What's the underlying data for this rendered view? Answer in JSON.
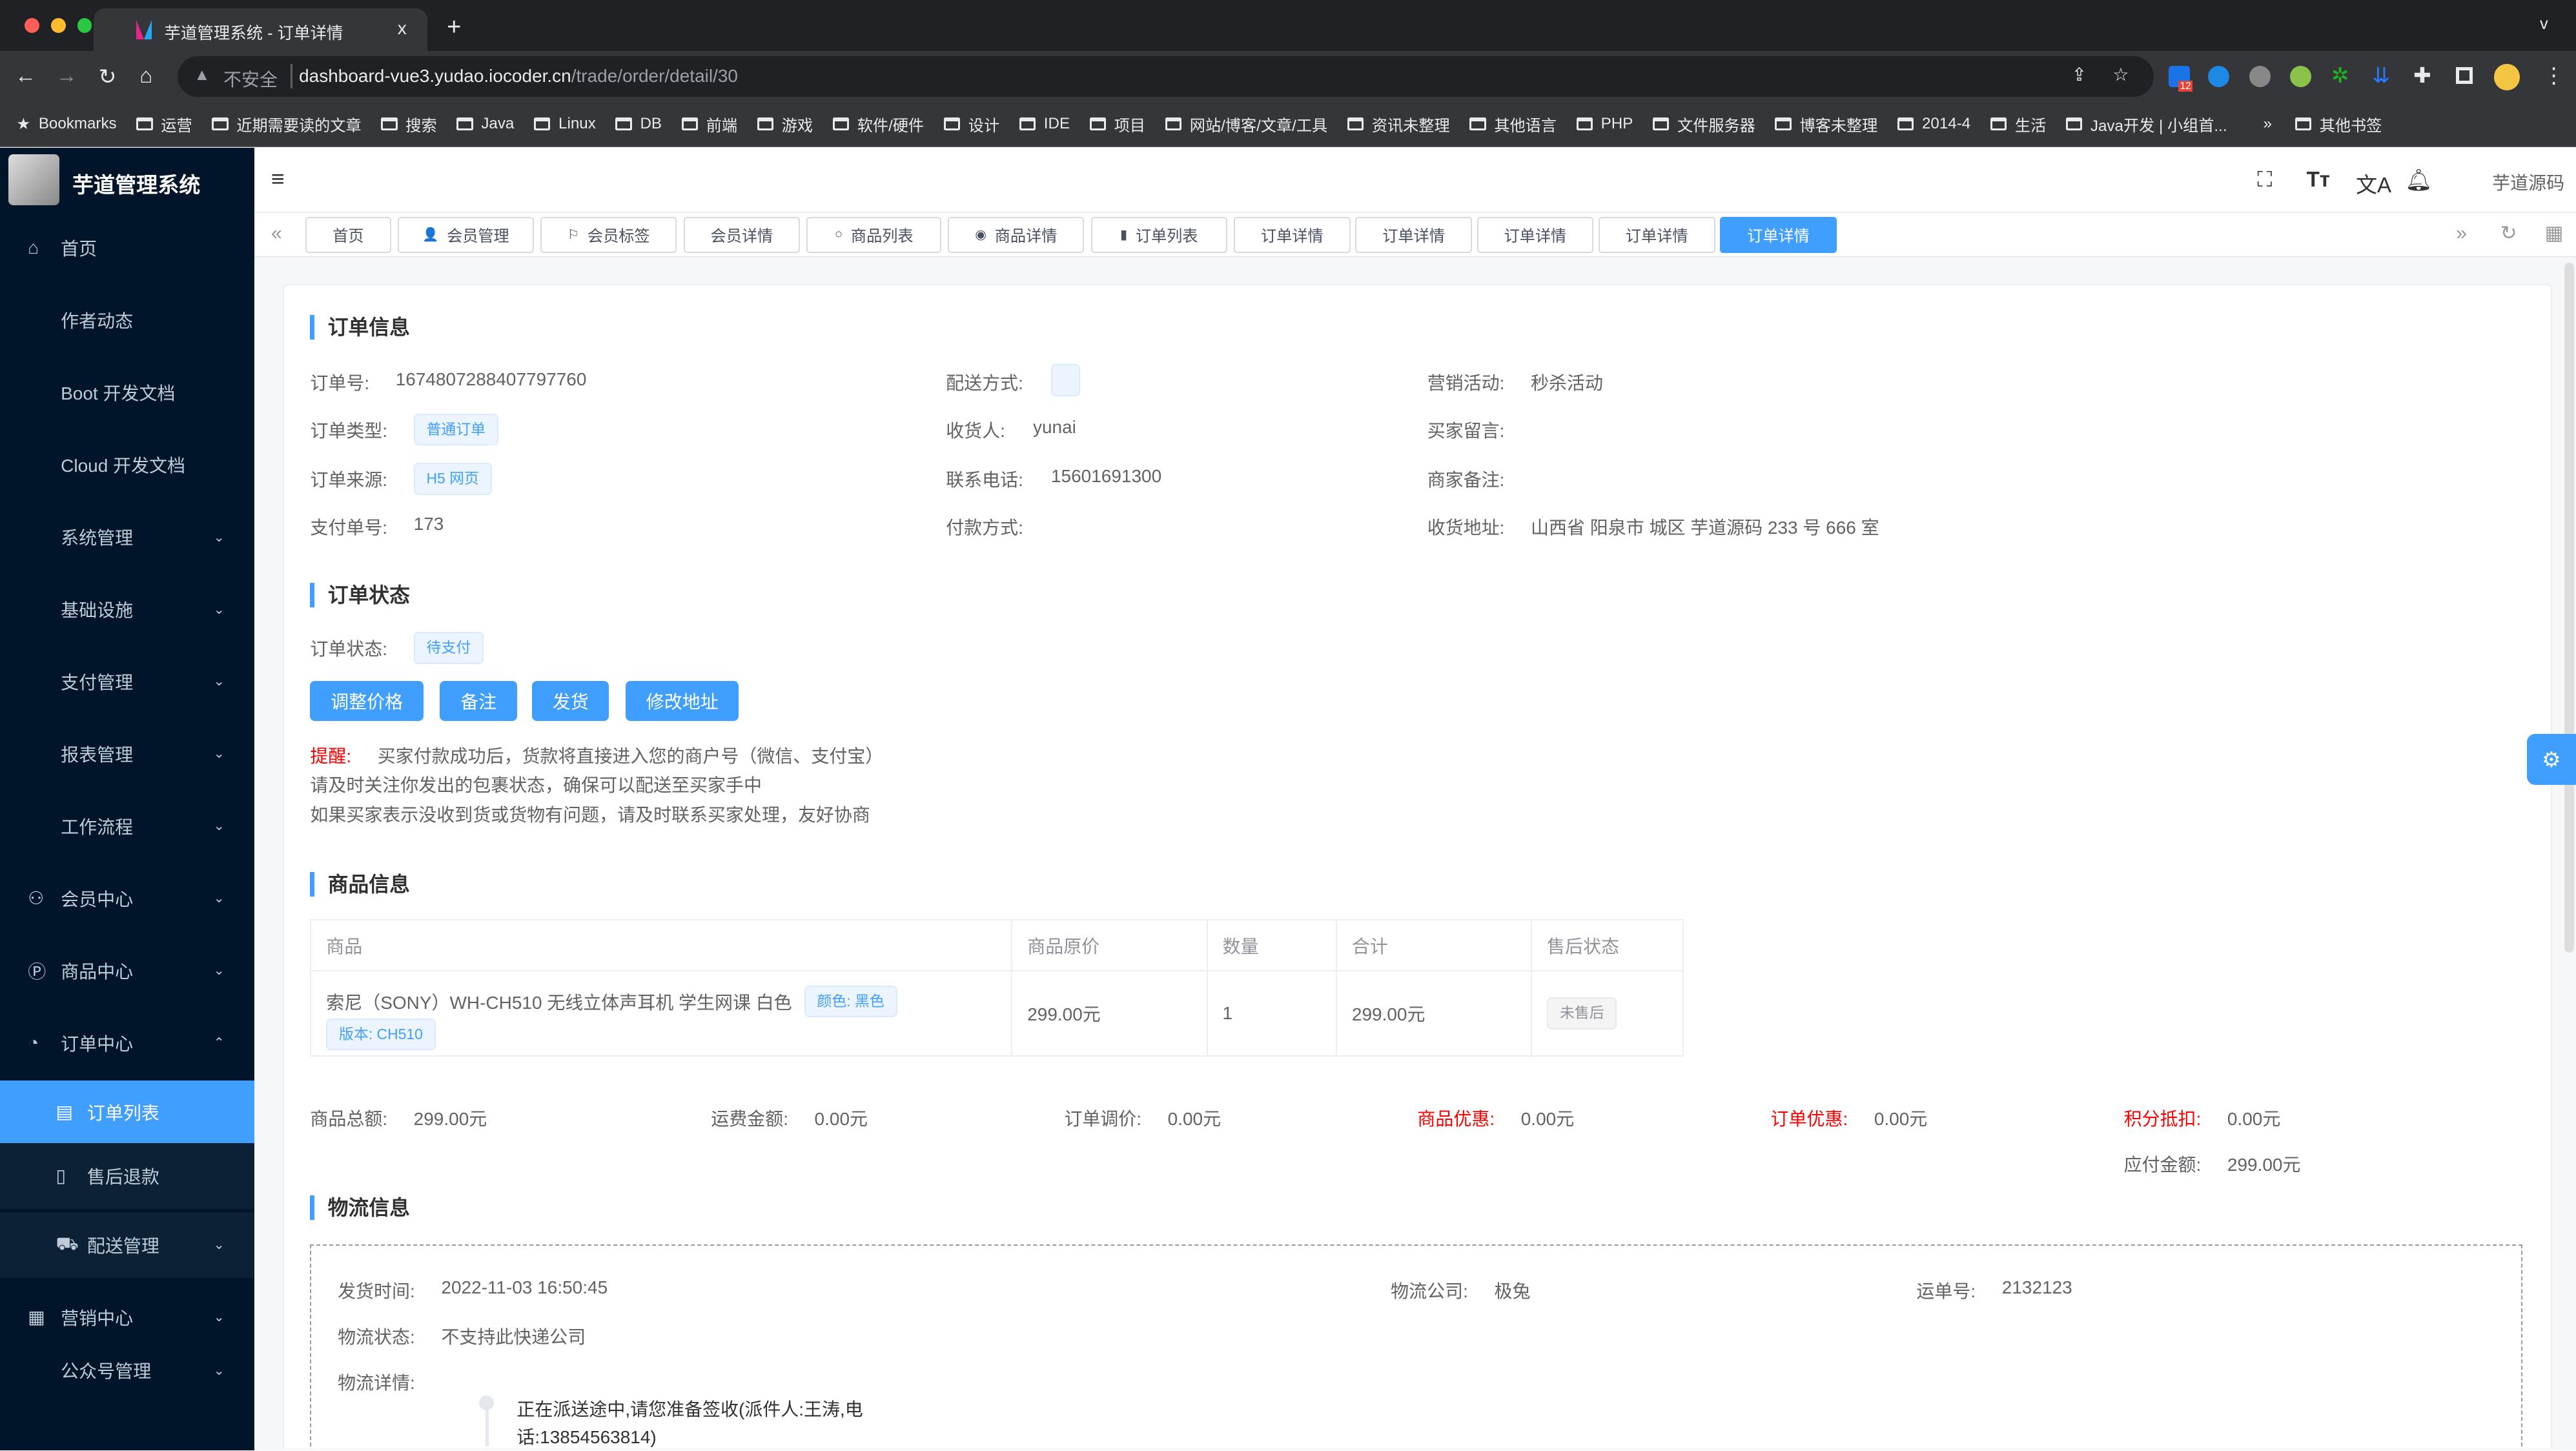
{
  "browser": {
    "tab_title": "芋道管理系统 - 订单详情",
    "close": "x",
    "new_tab": "+",
    "tab_menu": "v",
    "security": "不安全",
    "url_host": "dashboard-vue3.yudao.iocoder.cn",
    "url_path": "/trade/order/detail/30",
    "extension_badge": "12",
    "bookmarks": [
      "Bookmarks",
      "运营",
      "近期需要读的文章",
      "搜索",
      "Java",
      "Linux",
      "DB",
      "前端",
      "游戏",
      "软件/硬件",
      "设计",
      "IDE",
      "项目",
      "网站/博客/文章/工具",
      "资讯未整理",
      "其他语言",
      "PHP",
      "文件服务器",
      "博客未整理",
      "2014-4",
      "生活",
      "Java开发 | 小组首...",
      "»",
      "其他书签"
    ]
  },
  "app": {
    "title": "芋道管理系统",
    "header_user": "芋道源码",
    "menu": [
      {
        "label": "首页",
        "icon": "home-icon",
        "glyph": "⌂"
      },
      {
        "label": "作者动态"
      },
      {
        "label": "Boot 开发文档"
      },
      {
        "label": "Cloud 开发文档"
      },
      {
        "label": "系统管理",
        "arrow": "⌄"
      },
      {
        "label": "基础设施",
        "arrow": "⌄"
      },
      {
        "label": "支付管理",
        "arrow": "⌄"
      },
      {
        "label": "报表管理",
        "arrow": "⌄"
      },
      {
        "label": "工作流程",
        "arrow": "⌄"
      },
      {
        "label": "会员中心",
        "icon": "members-icon",
        "glyph": "⚇",
        "arrow": "⌄"
      },
      {
        "label": "商品中心",
        "icon": "product-icon",
        "glyph": "Ⓟ",
        "arrow": "⌄"
      },
      {
        "label": "订单中心",
        "icon": "order-icon",
        "glyph": "◔",
        "arrow": "⌃"
      },
      {
        "label": "订单列表",
        "icon": "list-icon",
        "glyph": "▤",
        "sub": true,
        "active": true
      },
      {
        "label": "售后退款",
        "icon": "refund-icon",
        "glyph": "▯",
        "sub": true
      },
      {
        "label": "配送管理",
        "icon": "cart-icon",
        "glyph": "⛟",
        "sub": true,
        "arrow": "⌄"
      },
      {
        "label": "营销中心",
        "icon": "marketing-icon",
        "glyph": "▦",
        "arrow": "⌄"
      },
      {
        "label": "公众号管理",
        "arrow": "⌄"
      }
    ],
    "tags": [
      {
        "label": "首页"
      },
      {
        "label": "会员管理",
        "glyph": "👤"
      },
      {
        "label": "会员标签",
        "glyph": "⚐"
      },
      {
        "label": "会员详情"
      },
      {
        "label": "商品列表",
        "glyph": "○"
      },
      {
        "label": "商品详情",
        "glyph": "◉"
      },
      {
        "label": "订单列表",
        "glyph": "▮"
      },
      {
        "label": "订单详情"
      },
      {
        "label": "订单详情"
      },
      {
        "label": "订单详情"
      },
      {
        "label": "订单详情"
      },
      {
        "label": "订单详情",
        "active": true
      }
    ]
  },
  "order_info": {
    "title": "订单信息",
    "order_no_label": "订单号:",
    "order_no": "1674807288407797760",
    "type_label": "订单类型:",
    "type": "普通订单",
    "source_label": "订单来源:",
    "source": "H5 网页",
    "pay_no_label": "支付单号:",
    "pay_no": "173",
    "delivery_label": "配送方式:",
    "receiver_label": "收货人:",
    "receiver": "yunai",
    "phone_label": "联系电话:",
    "phone": "15601691300",
    "pay_method_label": "付款方式:",
    "activity_label": "营销活动:",
    "activity": "秒杀活动",
    "buyer_remark_label": "买家留言:",
    "merchant_remark_label": "商家备注:",
    "address_label": "收货地址:",
    "address": "山西省 阳泉市 城区 芋道源码 233 号 666 室"
  },
  "order_status": {
    "title": "订单状态",
    "status_label": "订单状态:",
    "status": "待支付",
    "buttons": [
      "调整价格",
      "备注",
      "发货",
      "修改地址"
    ],
    "reminder_label": "提醒:",
    "reminder_lines": [
      "买家付款成功后，货款将直接进入您的商户号（微信、支付宝）",
      "请及时关注你发出的包裹状态，确保可以配送至买家手中",
      "如果买家表示没收到货或货物有问题，请及时联系买家处理，友好协商"
    ]
  },
  "products": {
    "title": "商品信息",
    "columns": [
      "商品",
      "商品原价",
      "数量",
      "合计",
      "售后状态"
    ],
    "rows": [
      {
        "name": "索尼（SONY）WH-CH510 无线立体声耳机 学生网课 白色",
        "props": [
          "颜色: 黑色",
          "版本: CH510"
        ],
        "price": "299.00元",
        "count": "1",
        "total": "299.00元",
        "after_sale": "未售后"
      }
    ]
  },
  "summary": {
    "total_label": "商品总额:",
    "total": "299.00元",
    "freight_label": "运费金额:",
    "freight": "0.00元",
    "adjust_label": "订单调价:",
    "adjust": "0.00元",
    "product_discount_label": "商品优惠:",
    "product_discount": "0.00元",
    "order_discount_label": "订单优惠:",
    "order_discount": "0.00元",
    "points_label": "积分抵扣:",
    "points": "0.00元",
    "pay_label": "应付金额:",
    "pay": "299.00元"
  },
  "logistics": {
    "title": "物流信息",
    "time_label": "发货时间:",
    "time": "2022-11-03 16:50:45",
    "company_label": "物流公司:",
    "company": "极兔",
    "waybill_label": "运单号:",
    "waybill": "2132123",
    "status_label": "物流状态:",
    "status": "不支持此快递公司",
    "detail_label": "物流详情:",
    "detail_lines": [
      "正在派送途中,请您准备签收(派件人:王涛,电",
      "话:13854563814)"
    ]
  },
  "colors": {
    "primary": "#409eff",
    "sidebar": "#001529",
    "danger": "#ff0000"
  }
}
